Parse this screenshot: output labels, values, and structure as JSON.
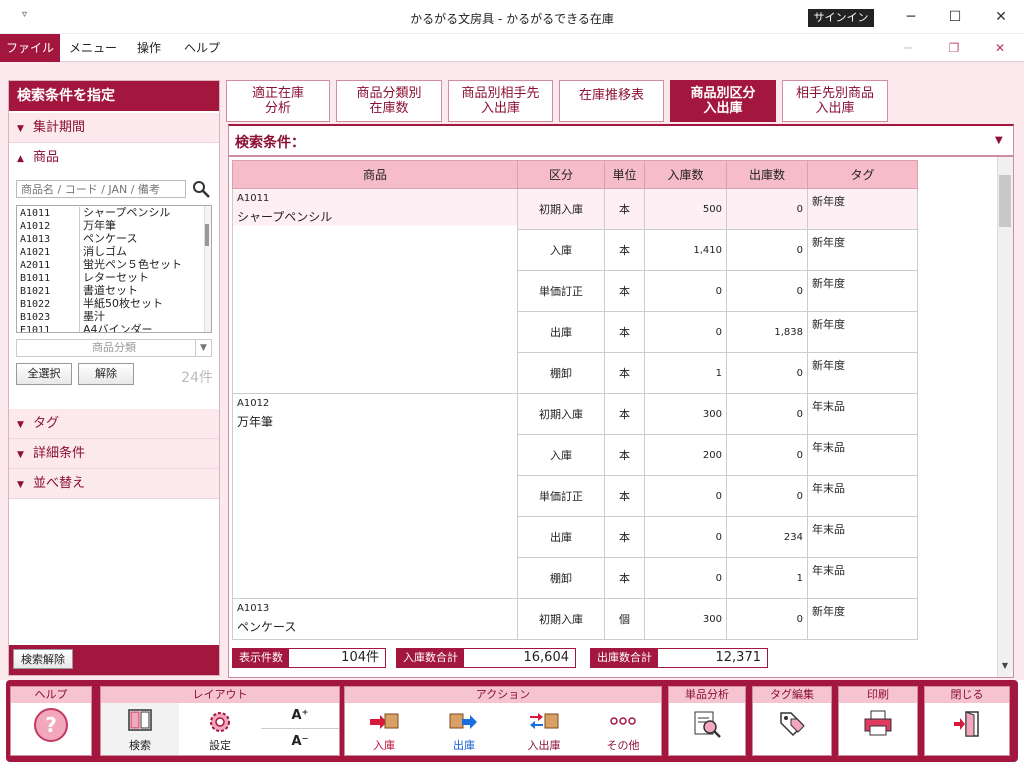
{
  "window": {
    "quick_access": "▿",
    "title": "かるがる文房具  -  かるがるできる在庫",
    "signin_label": "サインイン",
    "minimize": "─",
    "maximize": "☐",
    "close": "✕",
    "mdi_min": "─",
    "mdi_restore": "❐",
    "mdi_close": "✕"
  },
  "menu": {
    "file": "ファイル",
    "menu": "メニュー",
    "operation": "操作",
    "help": "ヘルプ"
  },
  "left_panel": {
    "header": "検索条件を指定",
    "sections": {
      "period": "集計期間",
      "product": "商品",
      "tag": "タグ",
      "detail": "詳細条件",
      "sort": "並べ替え"
    },
    "search_placeholder": "商品名 / コード / JAN / 備考",
    "products": [
      {
        "code": "A1011",
        "name": "シャープペンシル"
      },
      {
        "code": "A1012",
        "name": "万年筆"
      },
      {
        "code": "A1013",
        "name": "ペンケース"
      },
      {
        "code": "A1021",
        "name": "消しゴム"
      },
      {
        "code": "A2011",
        "name": "蛍光ペン５色セット"
      },
      {
        "code": "B1011",
        "name": "レターセット"
      },
      {
        "code": "B1021",
        "name": "書道セット"
      },
      {
        "code": "B1022",
        "name": "半紙50枚セット"
      },
      {
        "code": "B1023",
        "name": "墨汁"
      },
      {
        "code": "E1011",
        "name": "A4バインダー"
      }
    ],
    "category_placeholder": "商品分類",
    "select_all": "全選択",
    "deselect": "解除",
    "count": "24件",
    "clear_search": "検索解除"
  },
  "tabs": [
    {
      "line1": "適正在庫",
      "line2": "分析",
      "active": false
    },
    {
      "line1": "商品分類別",
      "line2": "在庫数",
      "active": false
    },
    {
      "line1": "商品別相手先",
      "line2": "入出庫",
      "active": false
    },
    {
      "line1": "在庫推移表",
      "line2": "",
      "active": false
    },
    {
      "line1": "商品別区分",
      "line2": "入出庫",
      "active": true
    },
    {
      "line1": "相手先別商品",
      "line2": "入出庫",
      "active": false
    }
  ],
  "condition_label": "検索条件：",
  "table": {
    "headers": [
      "商品",
      "区分",
      "単位",
      "入庫数",
      "出庫数",
      "タグ"
    ],
    "groups": [
      {
        "code": "A1011",
        "name": "シャープペンシル",
        "rows": [
          {
            "kubun": "初期入庫",
            "unit": "本",
            "in": "500",
            "out": "0",
            "tag": "新年度"
          },
          {
            "kubun": "入庫",
            "unit": "本",
            "in": "1,410",
            "out": "0",
            "tag": "新年度"
          },
          {
            "kubun": "単価訂正",
            "unit": "本",
            "in": "0",
            "out": "0",
            "tag": "新年度"
          },
          {
            "kubun": "出庫",
            "unit": "本",
            "in": "0",
            "out": "1,838",
            "tag": "新年度"
          },
          {
            "kubun": "棚卸",
            "unit": "本",
            "in": "1",
            "out": "0",
            "tag": "新年度"
          }
        ]
      },
      {
        "code": "A1012",
        "name": "万年筆",
        "rows": [
          {
            "kubun": "初期入庫",
            "unit": "本",
            "in": "300",
            "out": "0",
            "tag": "年末品"
          },
          {
            "kubun": "入庫",
            "unit": "本",
            "in": "200",
            "out": "0",
            "tag": "年末品"
          },
          {
            "kubun": "単価訂正",
            "unit": "本",
            "in": "0",
            "out": "0",
            "tag": "年末品"
          },
          {
            "kubun": "出庫",
            "unit": "本",
            "in": "0",
            "out": "234",
            "tag": "年末品"
          },
          {
            "kubun": "棚卸",
            "unit": "本",
            "in": "0",
            "out": "1",
            "tag": "年末品"
          }
        ]
      },
      {
        "code": "A1013",
        "name": "ペンケース",
        "rows": [
          {
            "kubun": "初期入庫",
            "unit": "個",
            "in": "300",
            "out": "0",
            "tag": "新年度"
          }
        ]
      }
    ]
  },
  "summary": {
    "display_count_label": "表示件数",
    "display_count": "104件",
    "in_total_label": "入庫数合計",
    "in_total": "16,604",
    "out_total_label": "出庫数合計",
    "out_total": "12,371"
  },
  "toolbar": {
    "help_group": "ヘルプ",
    "layout_group": "レイアウト",
    "search": "検索",
    "settings": "設定",
    "font_up": "A⁺",
    "font_down": "A⁻",
    "action_group": "アクション",
    "in": "入庫",
    "out": "出庫",
    "inout": "入出庫",
    "other": "その他",
    "single_analysis": "単品分析",
    "tag_edit": "タグ編集",
    "print": "印刷",
    "close": "閉じる"
  },
  "colors": {
    "accent": "#a3173f",
    "panel_bg": "#fbe9ee",
    "header_pink": "#f6bcc9"
  }
}
